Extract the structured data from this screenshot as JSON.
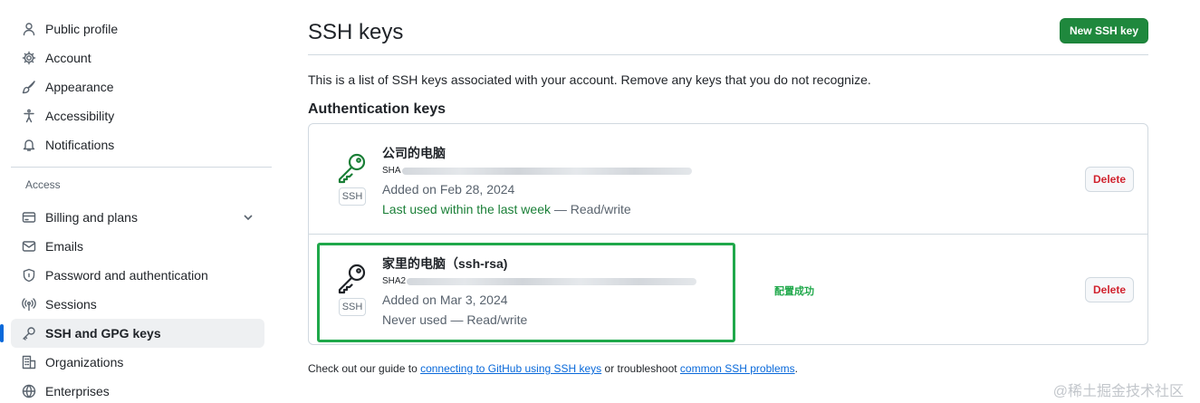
{
  "sidebar": {
    "items_top": [
      {
        "label": "Public profile",
        "icon": "person-icon"
      },
      {
        "label": "Account",
        "icon": "gear-icon"
      },
      {
        "label": "Appearance",
        "icon": "paintbrush-icon"
      },
      {
        "label": "Accessibility",
        "icon": "accessibility-icon"
      },
      {
        "label": "Notifications",
        "icon": "bell-icon"
      }
    ],
    "access_heading": "Access",
    "items_access": [
      {
        "label": "Billing and plans",
        "icon": "credit-card-icon"
      },
      {
        "label": "Emails",
        "icon": "mail-icon"
      },
      {
        "label": "Password and authentication",
        "icon": "shield-lock-icon"
      },
      {
        "label": "Sessions",
        "icon": "broadcast-icon"
      },
      {
        "label": "SSH and GPG keys",
        "icon": "key-icon",
        "active": true
      },
      {
        "label": "Organizations",
        "icon": "organization-icon"
      },
      {
        "label": "Enterprises",
        "icon": "globe-icon"
      }
    ]
  },
  "main": {
    "title": "SSH keys",
    "new_button": "New SSH key",
    "intro": "This is a list of SSH keys associated with your account. Remove any keys that you do not recognize.",
    "section_heading": "Authentication keys",
    "keys": [
      {
        "name": "公司的电脑",
        "badge": "SSH",
        "fingerprint_prefix": "SHA",
        "added": "Added on Feb 28, 2024",
        "last_used_recent": "Last used within the last week",
        "last_used_rest": " — Read/write",
        "delete_label": "Delete",
        "icon_color": "#1a7f37"
      },
      {
        "name": "家里的电脑（ssh-rsa)",
        "badge": "SSH",
        "fingerprint_prefix": "SHA2",
        "added": "Added on Mar 3, 2024",
        "last_used_recent": "",
        "last_used_rest": "Never used — Read/write",
        "delete_label": "Delete",
        "icon_color": "#1f2328"
      }
    ],
    "annotation": "配置成功",
    "footer": {
      "prefix": "Check out our guide to ",
      "link1": "connecting to GitHub using SSH keys",
      "middle": " or troubleshoot ",
      "link2": "common SSH problems",
      "suffix": "."
    }
  },
  "watermark": "@稀土掘金技术社区",
  "colors": {
    "primary_button": "#1f883d",
    "danger": "#d1242f",
    "link": "#0969da",
    "highlight_box": "#1fa84a",
    "active_indicator": "#0969da"
  }
}
